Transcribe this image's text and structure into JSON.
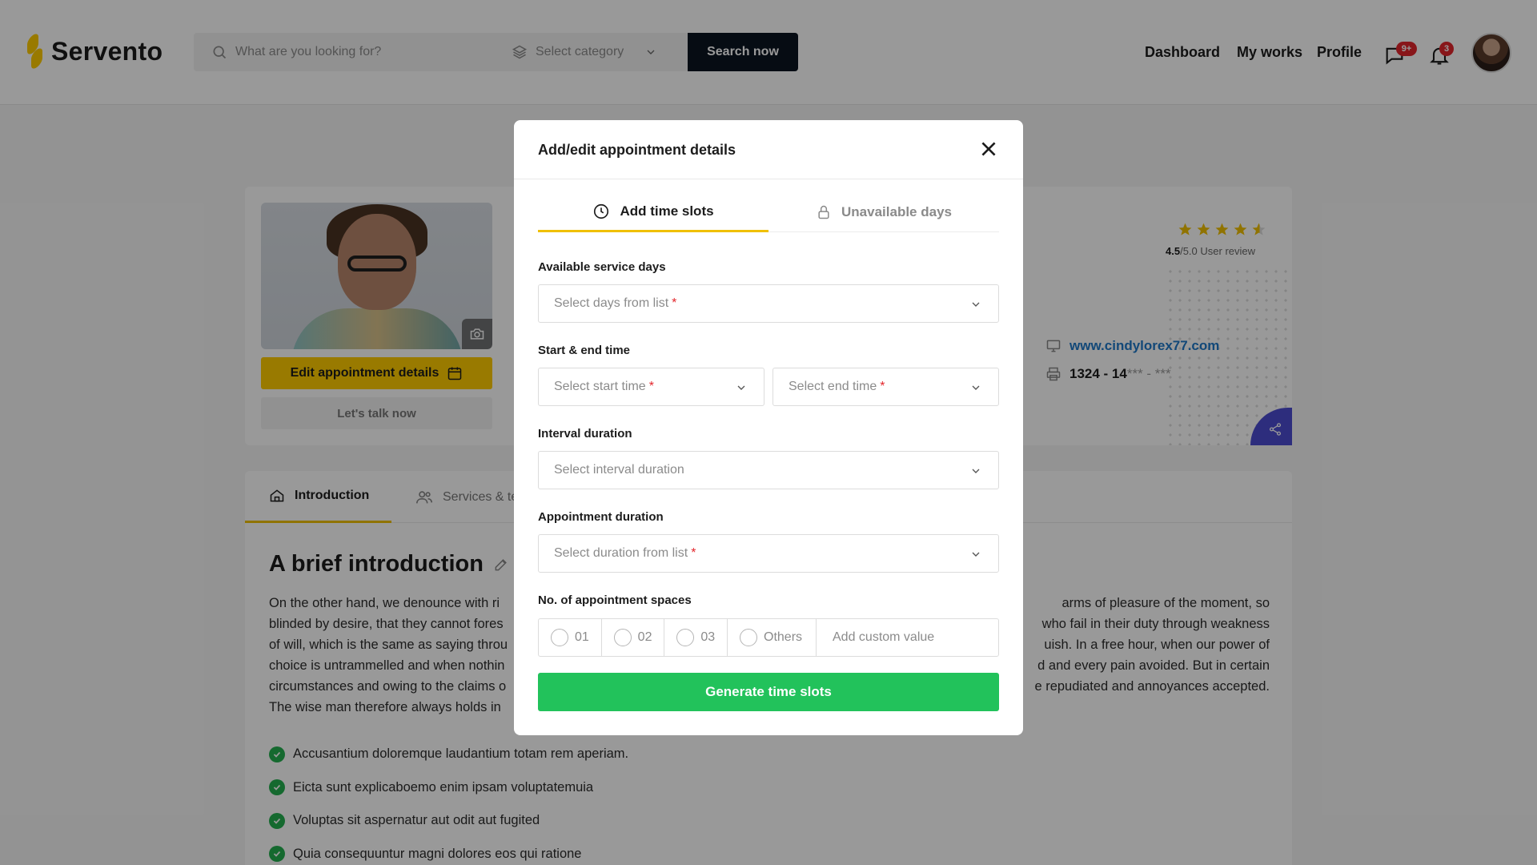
{
  "header": {
    "brand": "Servento",
    "search_placeholder": "What are you looking for?",
    "category_placeholder": "Select category",
    "search_button": "Search now",
    "nav": [
      "Dashboard",
      "My works",
      "Profile"
    ],
    "messages_badge": "9+",
    "notifications_badge": "3"
  },
  "profile": {
    "edit_button": "Edit appointment details",
    "talk_button": "Let's talk now",
    "rating": "4.5",
    "rating_max": "/5.0",
    "rating_caption": "User review",
    "website": "www.cindylorex77.com",
    "phone_visible": "1324 - 14",
    "phone_masked": "*** - ***"
  },
  "intro": {
    "tabs": [
      "Introduction",
      "Services & te"
    ],
    "title": "A brief introduction",
    "lines": [
      "On the other hand, we denounce with ri",
      "arms of pleasure of the moment, so",
      "blinded by desire, that they cannot fores",
      "who fail in their duty through weakness",
      "of will, which is the same as saying throu",
      "uish. In a free hour, when our power of",
      "choice is untrammelled and when nothin",
      "d and every pain avoided. But in certain",
      "circumstances and owing to the claims o",
      "e repudiated and annoyances accepted.",
      "The wise man therefore always holds in"
    ],
    "bullets": [
      "Accusantium doloremque laudantium totam rem aperiam.",
      "Eicta sunt explicaboemo enim ipsam voluptatemuia",
      "Voluptas sit aspernatur aut odit aut fugited",
      "Quia consequuntur magni dolores eos qui ratione"
    ]
  },
  "modal": {
    "title": "Add/edit appointment details",
    "tabs": [
      "Add time slots",
      "Unavailable days"
    ],
    "days_label": "Available service days",
    "days_placeholder": "Select days from list",
    "time_label": "Start & end time",
    "start_placeholder": "Select start time",
    "end_placeholder": "Select end time",
    "interval_label": "Interval duration",
    "interval_placeholder": "Select interval duration",
    "duration_label": "Appointment duration",
    "duration_placeholder": "Select duration from list",
    "spaces_label": "No. of appointment spaces",
    "space_options": [
      "01",
      "02",
      "03",
      "Others"
    ],
    "custom_placeholder": "Add custom value",
    "generate_button": "Generate time slots",
    "required_mark": "*"
  },
  "colors": {
    "accent_yellow": "#ffcc00",
    "generate_green": "#22c25b",
    "link_blue": "#1e78c8",
    "badge_red": "#e3262c",
    "search_button_bg": "#0b1420",
    "share_button_bg": "#4b4bd1"
  }
}
